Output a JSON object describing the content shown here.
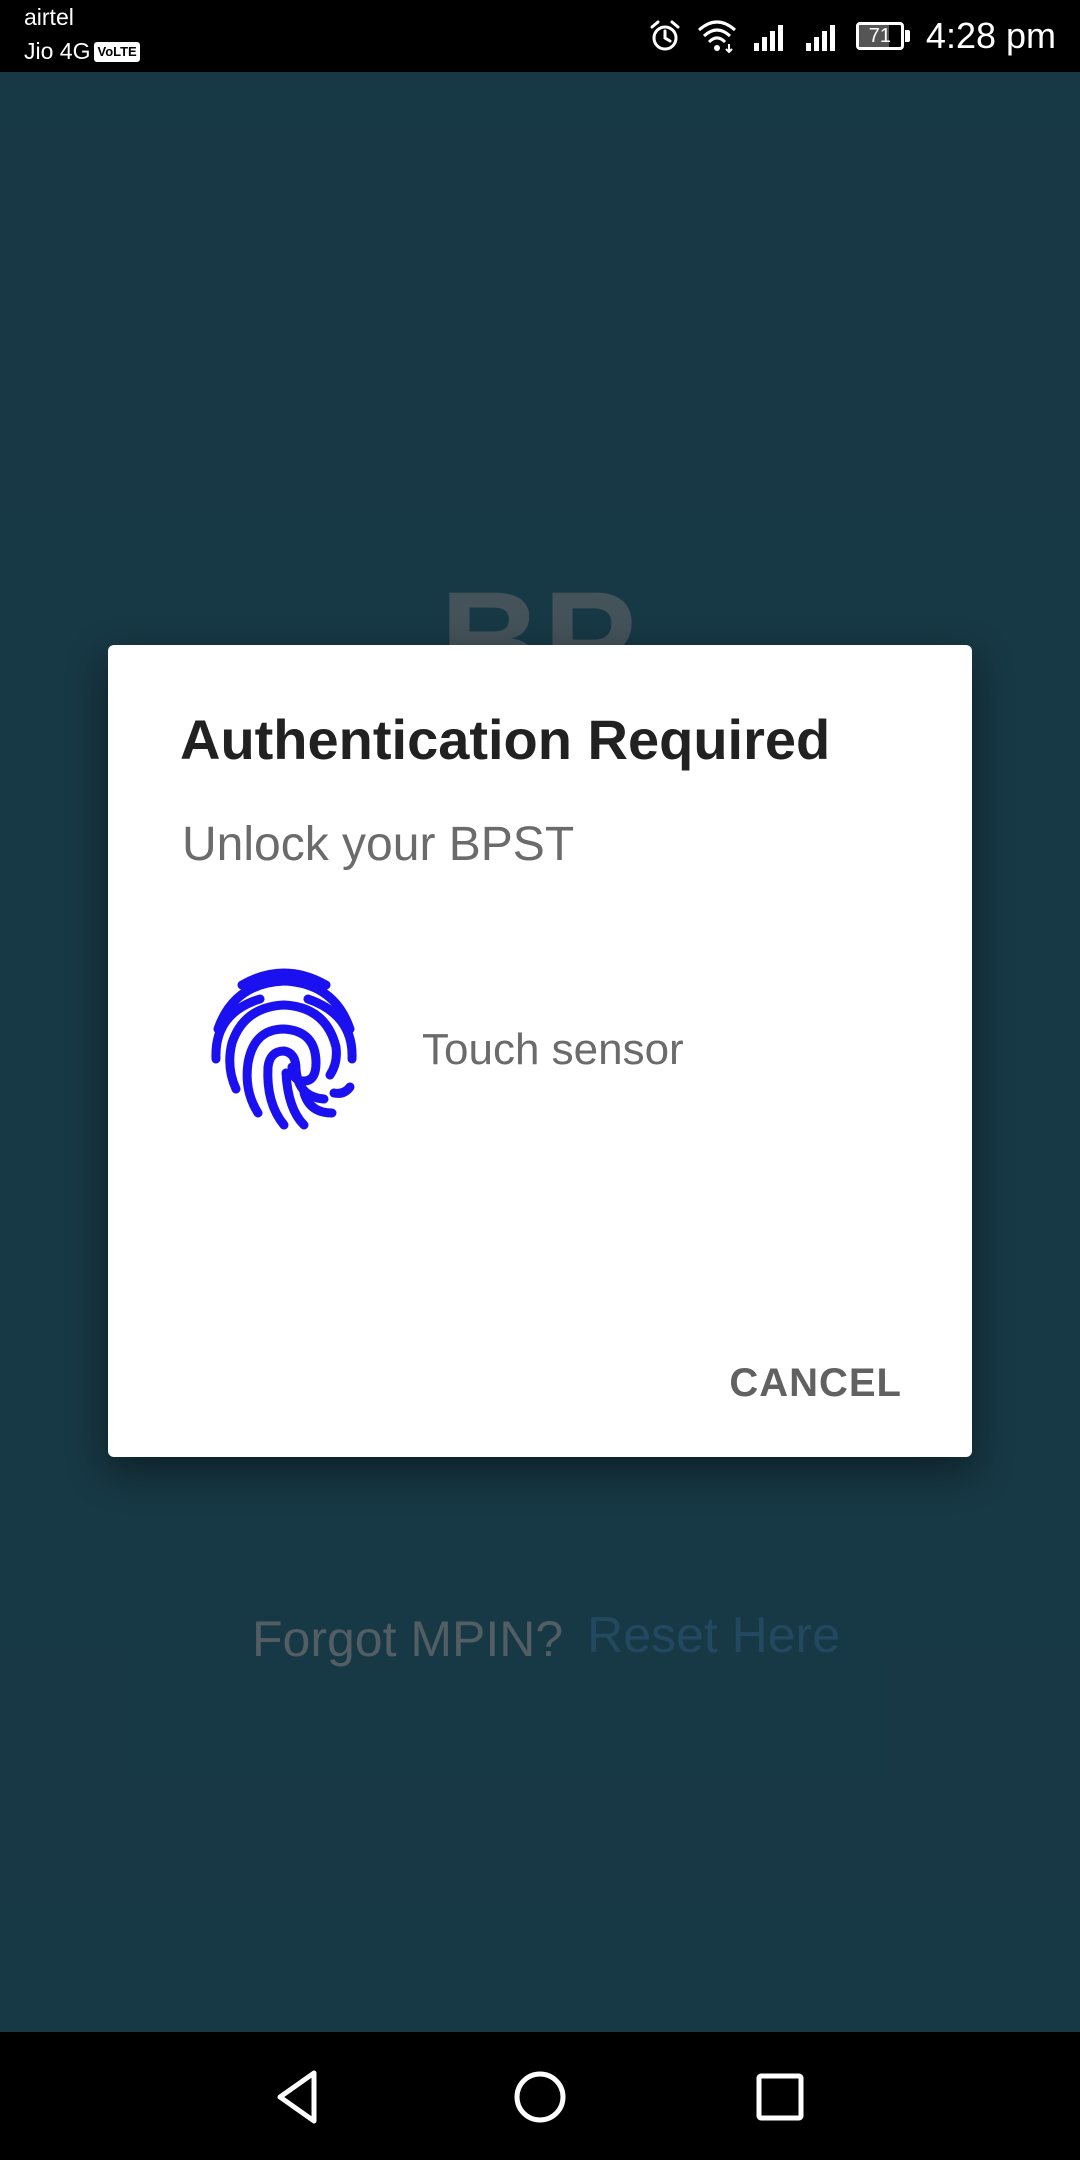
{
  "status_bar": {
    "carrier_primary": "airtel",
    "carrier_secondary": "Jio 4G",
    "volte_badge": "VoLTE",
    "battery_level": "71",
    "battery_fraction": 0.71,
    "time": "4:28 pm",
    "icons": [
      "alarm-icon",
      "wifi-icon",
      "signal-icon",
      "signal-icon",
      "battery-icon"
    ]
  },
  "background": {
    "logo_text": "BP",
    "forgot_text": "Forgot MPIN?",
    "reset_link": "Reset Here",
    "color": "#1a3d4b"
  },
  "dialog": {
    "title": "Authentication Required",
    "subtitle": "Unlock your BPST",
    "sensor_label": "Touch sensor",
    "cancel_label": "CANCEL",
    "fingerprint_color": "#1a10f0",
    "icon": "fingerprint-icon"
  },
  "nav_bar": {
    "buttons": [
      "back-icon",
      "home-icon",
      "recents-icon"
    ]
  }
}
